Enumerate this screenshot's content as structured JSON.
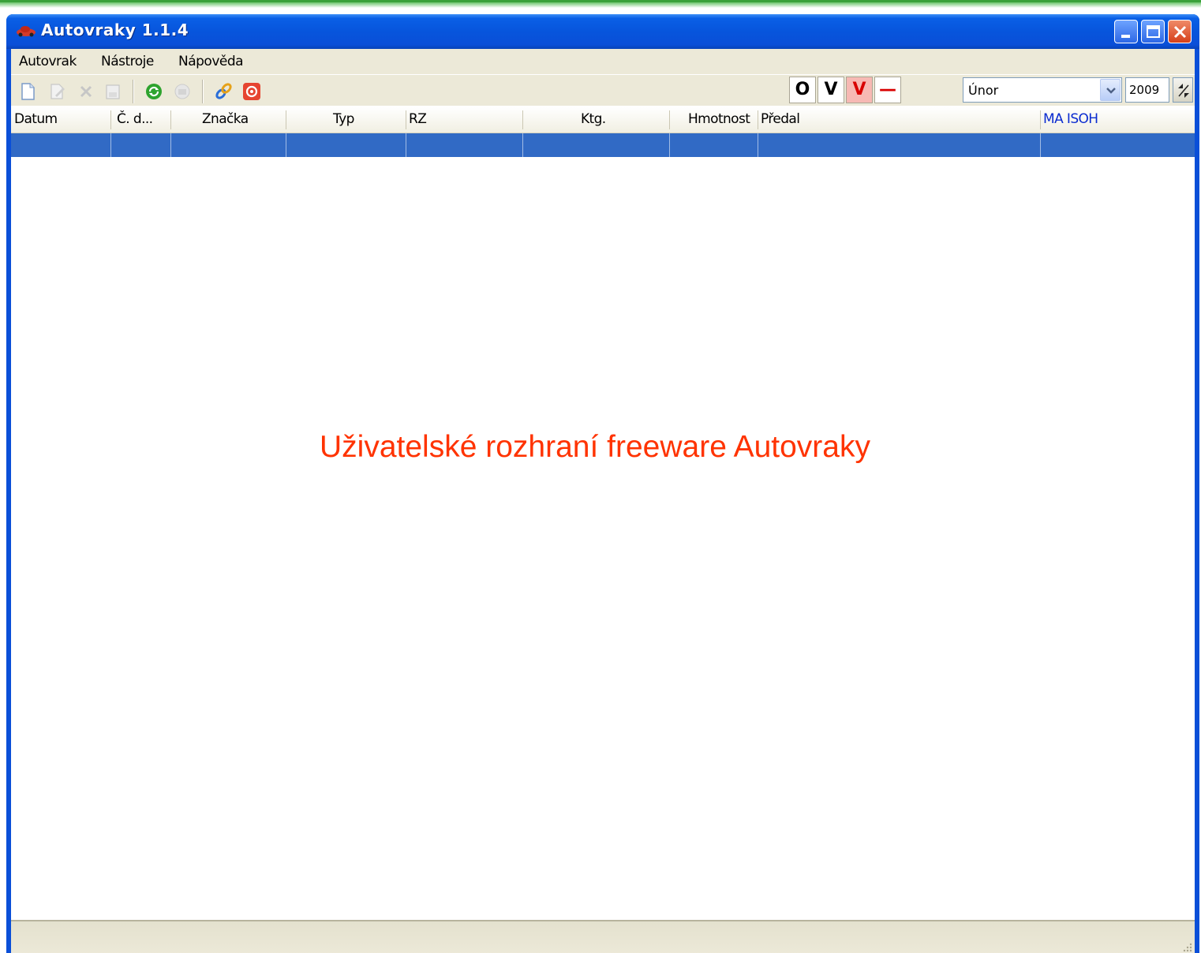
{
  "window": {
    "title": "Autovraky 1.1.4"
  },
  "menu": [
    "Autovrak",
    "Nástroje",
    "Nápověda"
  ],
  "toolbar": {
    "icons": [
      "new-document-icon",
      "edit-icon",
      "delete-icon",
      "save-icon",
      "refresh-icon",
      "print-icon",
      "link-icon",
      "power-icon"
    ],
    "mode_buttons": [
      "O",
      "V",
      "V",
      "—"
    ],
    "month": "Únor",
    "year": "2009"
  },
  "table": {
    "columns": [
      "Datum",
      "Č. d...",
      "Značka",
      "Typ",
      "RZ",
      "Ktg.",
      "Hmotnost",
      "Předal",
      "MA ISOH"
    ]
  },
  "caption": "Uživatelské rozhraní freeware Autovraky",
  "colors": {
    "titlebar": "#0a4fd8",
    "selection": "#316ac5",
    "caption": "#ff3300",
    "accent": "#3aa13a"
  }
}
